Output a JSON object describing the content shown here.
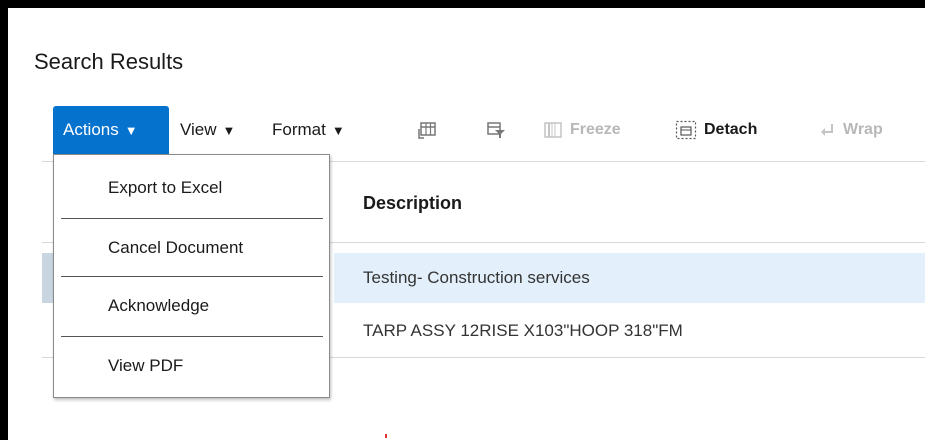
{
  "page": {
    "title": "Search Results"
  },
  "toolbar": {
    "actions_label": "Actions",
    "view_label": "View",
    "format_label": "Format",
    "freeze_label": "Freeze",
    "detach_label": "Detach",
    "wrap_label": "Wrap",
    "caret": "▼"
  },
  "table": {
    "description_header": "Description",
    "rows": [
      {
        "description": "Testing- Construction services"
      },
      {
        "description": "TARP ASSY 12RISE X103\"HOOP 318\"FM"
      }
    ]
  },
  "actions_menu": {
    "items": [
      {
        "label": "Export to Excel"
      },
      {
        "label": "Cancel Document"
      },
      {
        "label": "Acknowledge"
      },
      {
        "label": "View PDF"
      }
    ]
  },
  "colors": {
    "accent": "#0572ce",
    "selected_row": "#e3f0fb",
    "disabled": "#b8b8b8"
  }
}
